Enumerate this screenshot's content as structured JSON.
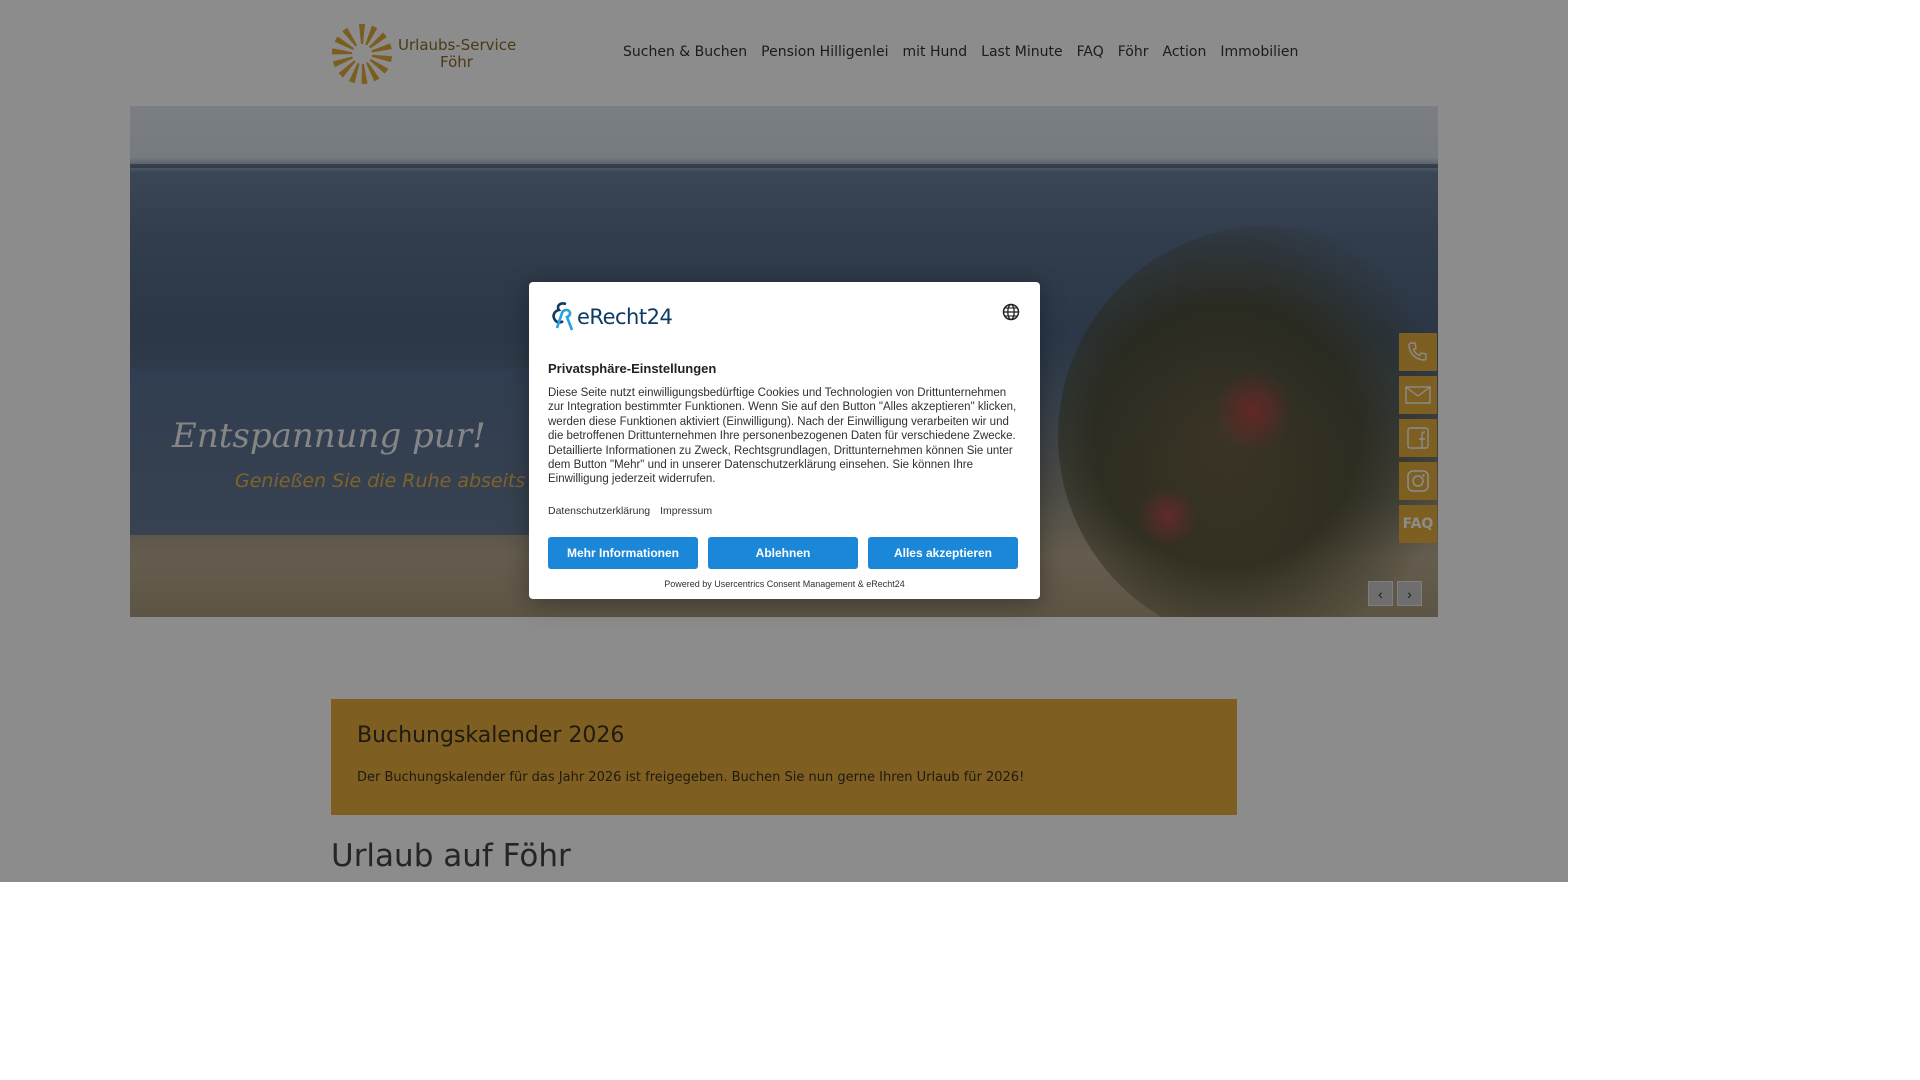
{
  "header": {
    "logo_line1": "Urlaubs-Service",
    "logo_line2": "Föhr",
    "nav": [
      "Suchen & Buchen",
      "Pension Hilligenlei",
      "mit Hund",
      "Last Minute",
      "FAQ",
      "Föhr",
      "Action",
      "Immobilien"
    ]
  },
  "hero": {
    "title": "Entspannung pur!",
    "subtitle": "Genießen Sie die Ruhe abseits"
  },
  "side_bar": {
    "faq_label": "FAQ"
  },
  "notice": {
    "title": "Buchungskalender 2026",
    "text": "Der Buchungskalender für das Jahr 2026 ist freigegeben. Buchen Sie nun gerne Ihren Urlaub für 2026!"
  },
  "section_title": "Urlaub auf Föhr",
  "consent": {
    "brand": "eRecht24",
    "heading": "Privatsphäre-Einstellungen",
    "body": "Diese Seite nutzt einwilligungsbedürftige Cookies und Technologien von Drittunternehmen zur Integration bestimmter Funktionen. Wenn Sie auf den Button \"Alles akzeptieren\" klicken, werden diese Funktionen aktiviert (Einwilligung). Nach der Einwilligung verarbeiten wir und die betroffenen Drittunternehmen Ihre personenbezogenen Daten für verschiedene Zwecke. Detaillierte Informationen zu Zweck, Rechtsgrundlagen, Drittunternehmen können Sie unter dem Button \"Mehr\" und in unserer Datenschutzerklärung einsehen. Sie können Ihre Einwilligung jederzeit widerrufen.",
    "link_privacy": "Datenschutzerklärung",
    "link_imprint": "Impressum",
    "btn_more": "Mehr Informationen",
    "btn_decline": "Ablehnen",
    "btn_accept": "Alles akzeptieren",
    "powered": "Powered by Usercentrics Consent Management & eRecht24"
  },
  "colors": {
    "accent": "#e8ad3d",
    "button_blue": "#1a87d8",
    "brand_navy": "#0d3a64"
  }
}
